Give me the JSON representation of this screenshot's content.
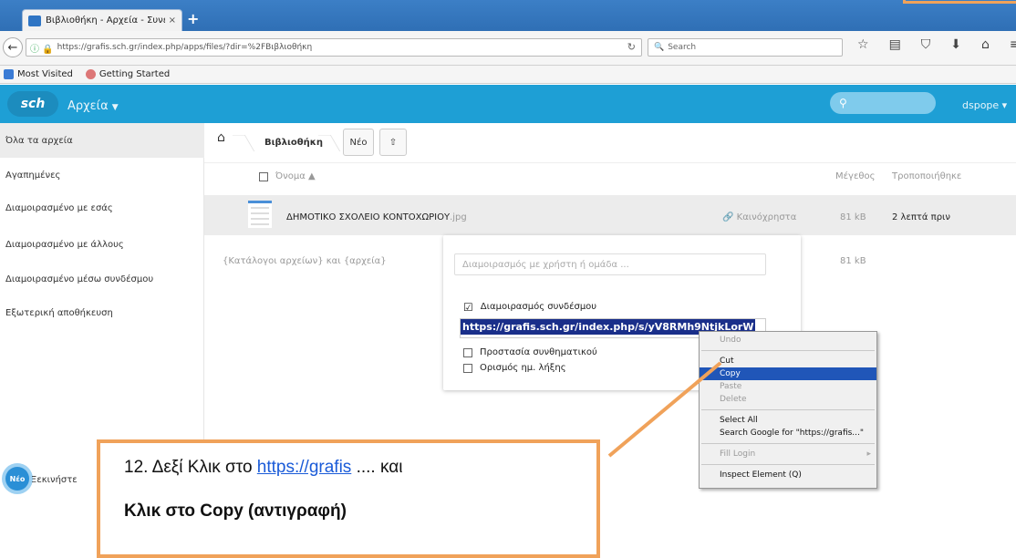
{
  "browser": {
    "tab_title": "Βιβλιοθήκη - Αρχεία - Συνεργ...",
    "tab_close": "×",
    "new_tab": "+",
    "url": "https://grafis.sch.gr/index.php/apps/files/?dir=%2FΒιβλιοθήκη",
    "search_placeholder": "Search",
    "bookmarks": [
      "Most Visited",
      "Getting Started"
    ]
  },
  "app": {
    "logo_text": "sch",
    "title": "Αρχεία",
    "user": "dspope ▾"
  },
  "sidebar": {
    "items": [
      {
        "label": "Όλα τα αρχεία"
      },
      {
        "label": "Αγαπημένες"
      },
      {
        "label": "Διαμοιρασμένο με εσάς"
      },
      {
        "label": "Διαμοιρασμένο με άλλους"
      },
      {
        "label": "Διαμοιρασμένο μέσω συνδέσμου"
      },
      {
        "label": "Εξωτερική αποθήκευση"
      }
    ],
    "new_badge": "Νέο",
    "new_text": "Ξεκινήστε"
  },
  "main": {
    "breadcrumb": "Βιβλιοθήκη",
    "new_button": "Νέο",
    "columns": {
      "name": "Όνομα ▲",
      "size": "Μέγεθος",
      "modified": "Τροποποιήθηκε"
    },
    "file": {
      "name": "ΔΗΜΟΤΙΚΟ ΣΧΟΛΕΙΟ ΚΟΝΤΟΧΩΡΙΟΥ",
      "ext": ".jpg",
      "share_label": "Καινόχρηστα",
      "size": "81 kB",
      "modified": "2 λεπτά πριν"
    },
    "summary": "{Κατάλογοι αρχείων} και {αρχεία}",
    "summary_size": "81 kB"
  },
  "share_popover": {
    "input_placeholder": "Διαμοιρασμός με χρήστη ή ομάδα ...",
    "link_share_label": "Διαμοιρασμός συνδέσμου",
    "link_url": "https://grafis.sch.gr/index.php/s/yV8RMh9NtjkLorW",
    "password_label": "Προστασία συνθηματικού",
    "expiry_label": "Ορισμός ημ. λήξης"
  },
  "context_menu": {
    "items": [
      "Undo",
      "Cut",
      "Copy",
      "Paste",
      "Delete",
      "Select All",
      "Search Google for \"https://grafis...\"",
      "Fill Login",
      "Inspect Element (Q)"
    ]
  },
  "annotation": {
    "line1_prefix": "12. Δεξί Κλικ στο ",
    "line1_link": "https://grafis",
    "line1_suffix": " .... και",
    "line2": "Κλικ στο Copy (αντιγραφή)",
    "border_color": "#f0a25a"
  }
}
